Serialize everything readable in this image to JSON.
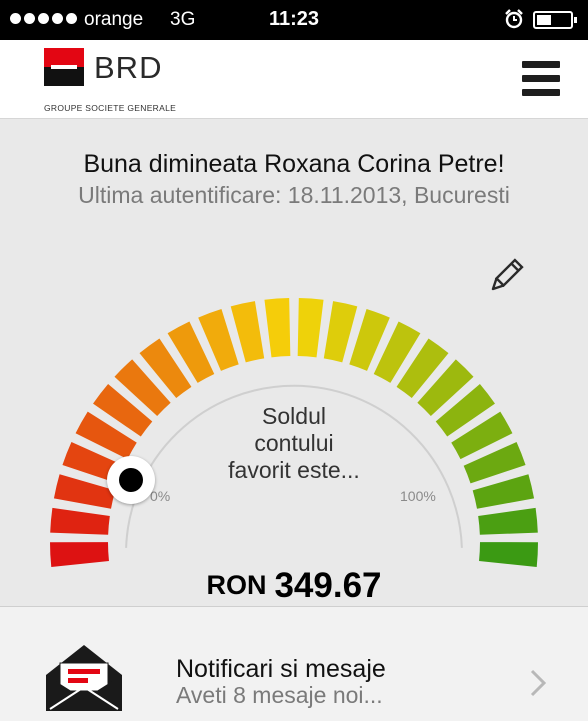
{
  "status_bar": {
    "carrier": "orange",
    "network": "3G",
    "time": "11:23"
  },
  "header": {
    "logo_text": "BRD",
    "logo_subtitle": "GROUPE SOCIETE GENERALE",
    "menu_icon": "hamburger-menu-icon"
  },
  "greeting": {
    "title": "Buna dimineata Roxana Corina Petre!",
    "last_login": "Ultima autentificare: 18.11.2013, Bucuresti"
  },
  "gauge": {
    "label": "Soldul contului favorit este...",
    "label_lines": [
      "Soldul",
      "contului",
      "favorit este..."
    ],
    "min_label": "0%",
    "max_label": "100%",
    "level_percent": 6,
    "segment_count": 24,
    "color_start": "#dd1212",
    "color_mid": "#f6d50a",
    "color_end": "#3b9a13",
    "edit_icon": "pencil-icon"
  },
  "balance": {
    "currency": "RON",
    "amount": "349.67"
  },
  "notifications": {
    "title": "Notificari si mesaje",
    "subtitle": "Aveti 8 mesaje noi...",
    "icon": "envelope-icon",
    "chevron": "chevron-right-icon"
  }
}
